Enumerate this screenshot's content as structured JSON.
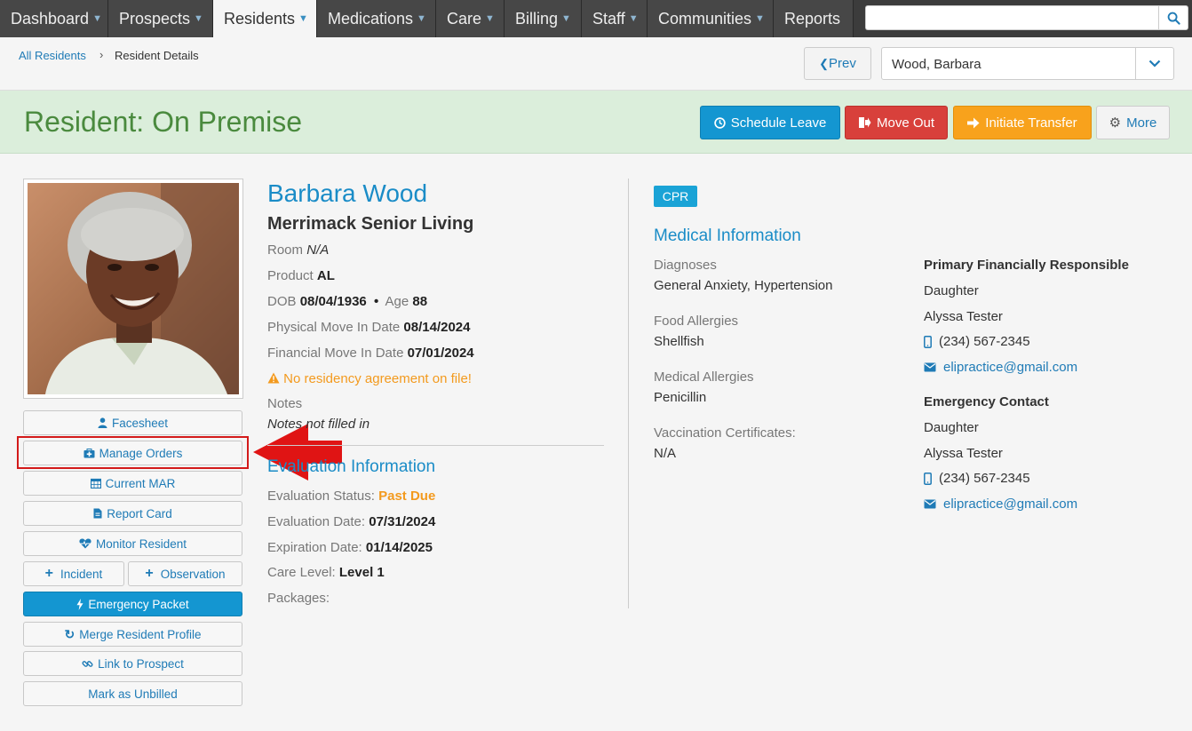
{
  "nav": {
    "items": [
      {
        "label": "Dashboard",
        "caret": true
      },
      {
        "label": "Prospects",
        "caret": true
      },
      {
        "label": "Residents",
        "caret": true,
        "active": true
      },
      {
        "label": "Medications",
        "caret": true
      },
      {
        "label": "Care",
        "caret": true
      },
      {
        "label": "Billing",
        "caret": true
      },
      {
        "label": "Staff",
        "caret": true
      },
      {
        "label": "Communities",
        "caret": true
      },
      {
        "label": "Reports",
        "caret": false
      }
    ],
    "search_placeholder": ""
  },
  "breadcrumb": {
    "root": "All Residents",
    "separator": "›",
    "current": "Resident Details"
  },
  "pager": {
    "prev_label": "Prev",
    "selected_resident": "Wood, Barbara"
  },
  "banner": {
    "title": "Resident: On Premise",
    "actions": {
      "schedule_leave": "Schedule Leave",
      "move_out": "Move Out",
      "initiate_transfer": "Initiate Transfer",
      "more": "More"
    }
  },
  "sidebar": {
    "facesheet": "Facesheet",
    "manage_orders": "Manage Orders",
    "current_mar": "Current MAR",
    "report_card": "Report Card",
    "monitor_resident": "Monitor Resident",
    "incident": "Incident",
    "observation": "Observation",
    "emergency_packet": "Emergency Packet",
    "merge_profile": "Merge Resident Profile",
    "link_prospect": "Link to Prospect",
    "mark_unbilled": "Mark as Unbilled"
  },
  "resident": {
    "name": "Barbara Wood",
    "community": "Merrimack Senior Living",
    "room_label": "Room",
    "room": "N/A",
    "product_label": "Product",
    "product": "AL",
    "dob_label": "DOB",
    "dob": "08/04/1936",
    "bullet": "•",
    "age_label": "Age",
    "age": "88",
    "physical_move_in_label": "Physical Move In Date",
    "physical_move_in": "08/14/2024",
    "financial_move_in_label": "Financial Move In Date",
    "financial_move_in": "07/01/2024",
    "warning": "No residency agreement on file!",
    "notes_label": "Notes",
    "notes": "Notes not filled in"
  },
  "evaluation": {
    "title": "Evaluation Information",
    "status_label": "Evaluation Status:",
    "status": "Past Due",
    "date_label": "Evaluation Date:",
    "date": "07/31/2024",
    "expiration_label": "Expiration Date:",
    "expiration": "01/14/2025",
    "care_level_label": "Care Level:",
    "care_level": "Level 1",
    "packages_label": "Packages:"
  },
  "medical": {
    "badge": "CPR",
    "title": "Medical Information",
    "diagnoses_label": "Diagnoses",
    "diagnoses": "General Anxiety, Hypertension",
    "food_allergies_label": "Food Allergies",
    "food_allergies": "Shellfish",
    "medical_allergies_label": "Medical Allergies",
    "medical_allergies": "Penicillin",
    "vaccination_label": "Vaccination Certificates:",
    "vaccination": "N/A"
  },
  "contacts": {
    "financial": {
      "heading": "Primary Financially Responsible",
      "relation": "Daughter",
      "name": "Alyssa Tester",
      "phone": "(234) 567-2345",
      "email": "elipractice@gmail.com"
    },
    "emergency": {
      "heading": "Emergency Contact",
      "relation": "Daughter",
      "name": "Alyssa Tester",
      "phone": "(234) 567-2345",
      "email": "elipractice@gmail.com"
    }
  },
  "colors": {
    "accent": "#1a8cc7",
    "banner_green": "#4a8a3e",
    "warning": "#f39a1e",
    "danger": "#d8403b",
    "annotation_red": "#d31a1a"
  }
}
